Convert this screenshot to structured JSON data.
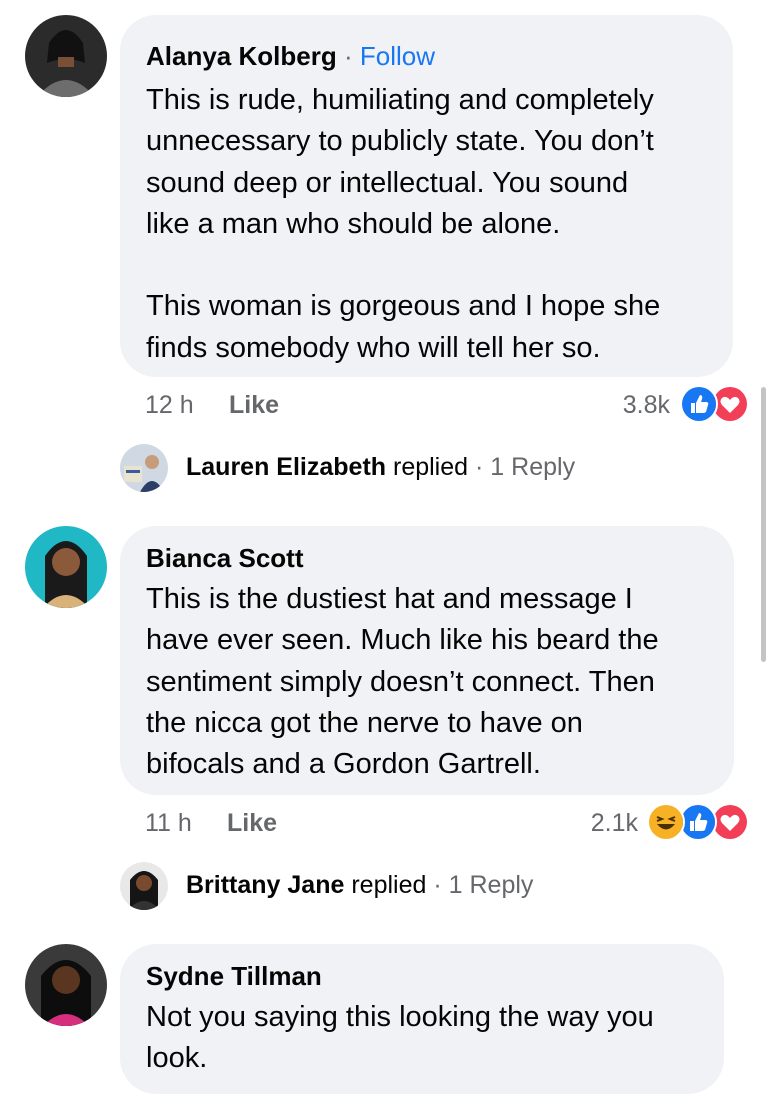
{
  "colors": {
    "bubble": "#f0f2f5",
    "link": "#1877f2",
    "muted": "#65676b",
    "like_blue": "#1877f2",
    "love_red": "#f33e58",
    "haha_yellow": "#f7b125"
  },
  "comments": [
    {
      "author": "Alanya Kolberg",
      "separator": "·",
      "follow_label": "Follow",
      "text": "This is rude, humiliating and completely\nunnecessary to publicly state. You don’t\nsound deep or intellectual. You sound\nlike a man who should be alone.\n\nThis woman is gorgeous and I hope she\nfinds somebody who will tell her so.",
      "time": "12 h",
      "like_label": "Like",
      "reaction_count": "3.8k",
      "reactions": [
        "like-icon",
        "love-icon"
      ],
      "reply": {
        "name": "Lauren Elizabeth",
        "verb": "replied",
        "separator": "·",
        "count": "1 Reply"
      }
    },
    {
      "author": "Bianca Scott",
      "text": "This is the dustiest hat and message I\nhave ever seen. Much like his beard the\nsentiment simply doesn’t connect. Then\nthe nicca got the nerve to have on\nbifocals and a Gordon Gartrell.",
      "time": "11 h",
      "like_label": "Like",
      "reaction_count": "2.1k",
      "reactions": [
        "haha-icon",
        "like-icon",
        "love-icon"
      ],
      "reply": {
        "name": "Brittany Jane",
        "verb": "replied",
        "separator": "·",
        "count": "1 Reply"
      }
    },
    {
      "author": "Sydne Tillman",
      "text": "Not you saying this looking the way you\nlook."
    }
  ]
}
